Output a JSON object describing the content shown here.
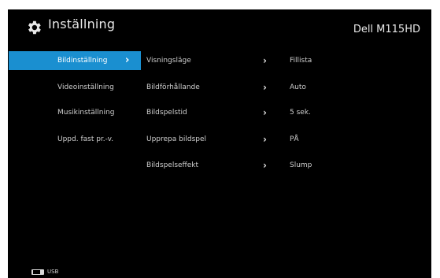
{
  "header": {
    "title": "Inställning",
    "model": "Dell M115HD"
  },
  "sidebar": {
    "items": [
      {
        "label": "Bildinställning",
        "active": true
      },
      {
        "label": "Videoinställning",
        "active": false
      },
      {
        "label": "Musikinställning",
        "active": false
      },
      {
        "label": "Uppd. fast pr.-v.",
        "active": false
      }
    ]
  },
  "settings": {
    "rows": [
      {
        "label": "Visningsläge",
        "value": "Fillista"
      },
      {
        "label": "Bildförhållande",
        "value": "Auto"
      },
      {
        "label": "Bildspelstid",
        "value": "5 sek."
      },
      {
        "label": "Upprepa bildspel",
        "value": "PÅ"
      },
      {
        "label": "Bildspelseffekt",
        "value": "Slump"
      }
    ]
  },
  "footer": {
    "source_label": "USB"
  },
  "icons": {
    "header": "gear-icon",
    "chevron": "chevron-right-icon",
    "source": "usb-icon"
  },
  "colors": {
    "background": "#000000",
    "accent": "#1a8fd0",
    "text": "#cfcfcf"
  }
}
